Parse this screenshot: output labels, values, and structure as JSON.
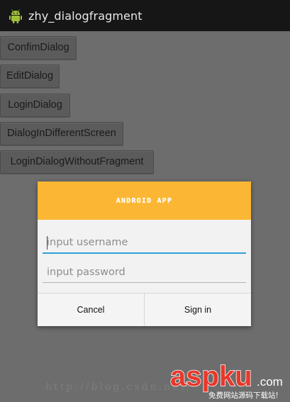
{
  "app": {
    "title": "zhy_dialogfragment",
    "icon": "android-robot-icon"
  },
  "activity_buttons": [
    {
      "label": "ConfimDialog"
    },
    {
      "label": "EditDialog"
    },
    {
      "label": "LoginDialog"
    },
    {
      "label": "DialogInDifferentScreen"
    },
    {
      "label": "LoginDialogWithoutFragment"
    }
  ],
  "dialog": {
    "title": "ANDROID APP",
    "username_placeholder": "input username",
    "password_placeholder": "input password",
    "cancel_label": "Cancel",
    "signin_label": "Sign in"
  },
  "watermark": {
    "url_text": "http://blog.csdn.net/",
    "logo_text": "aspku",
    "logo_suffix": ".com",
    "logo_tagline": "免费网站源码下载站!"
  },
  "colors": {
    "header": "#fbb734",
    "focus_underline": "#2fa1d8",
    "logo_red": "#e8382a"
  }
}
